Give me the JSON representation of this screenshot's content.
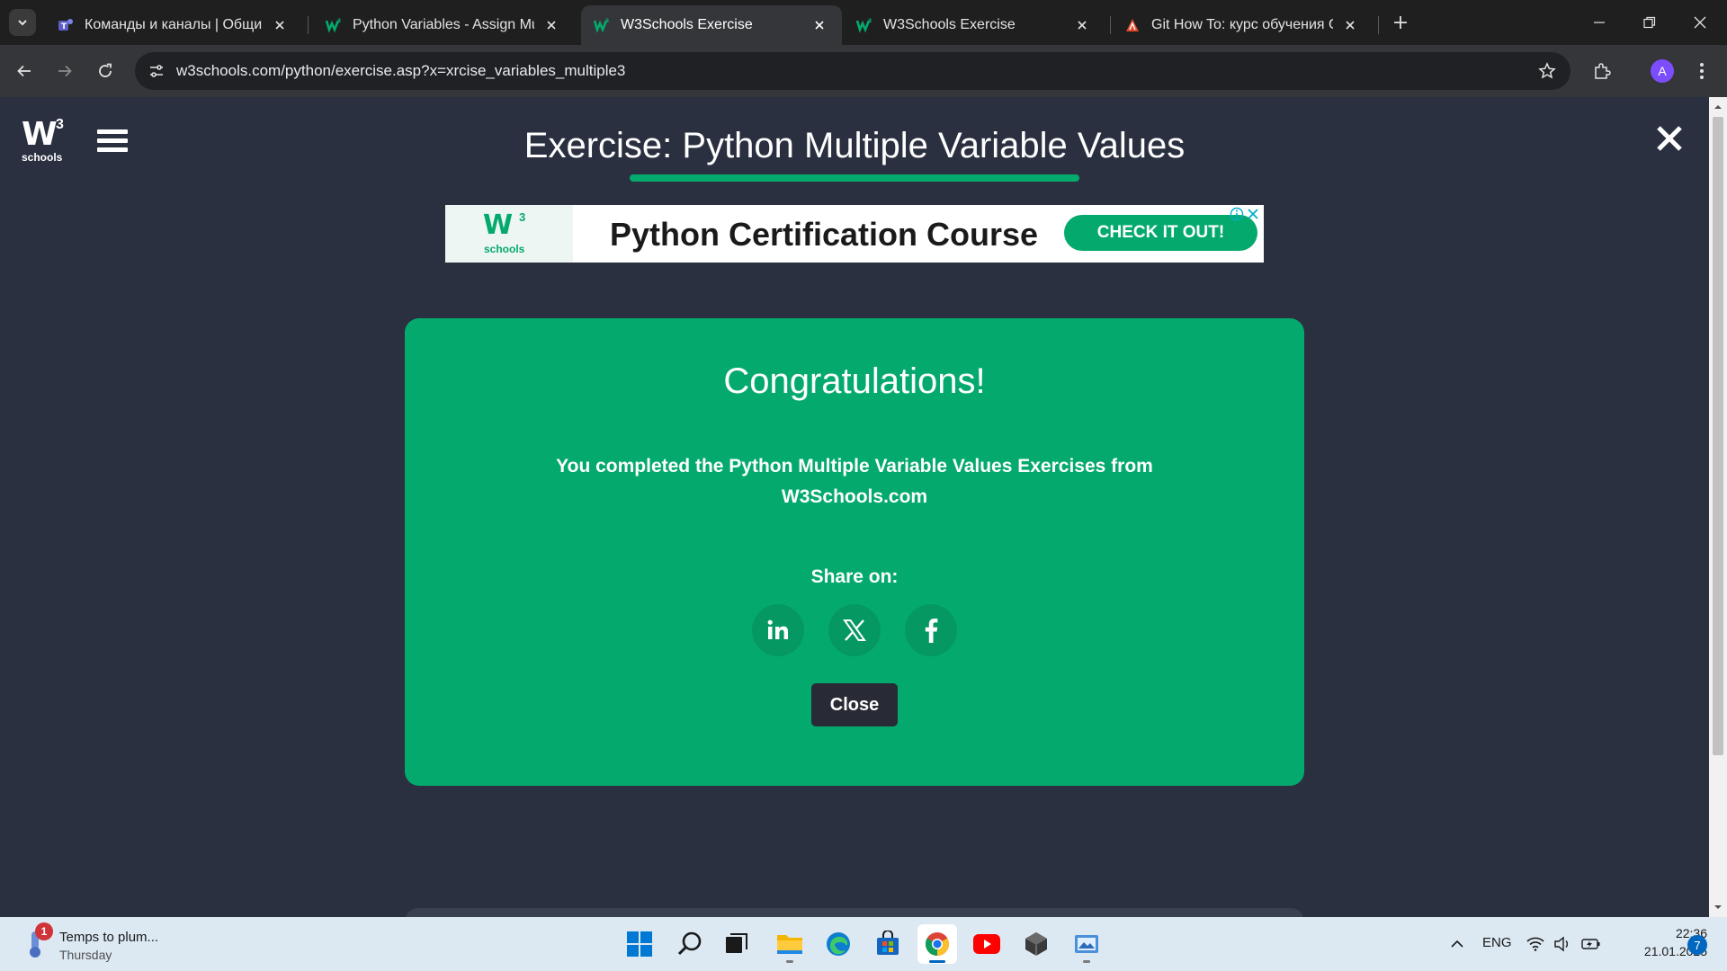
{
  "browser": {
    "tabs": [
      {
        "title": "Команды и каналы | Общий | M",
        "icon": "teams-icon",
        "active": false
      },
      {
        "title": "Python Variables - Assign Multip",
        "icon": "w3schools-favicon",
        "active": false
      },
      {
        "title": "W3Schools Exercise",
        "icon": "w3schools-favicon",
        "active": true
      },
      {
        "title": "W3Schools Exercise",
        "icon": "w3schools-favicon",
        "active": false
      },
      {
        "title": "Git How To: курс обучения Git",
        "icon": "git-howto-icon",
        "active": false
      }
    ],
    "url": "w3schools.com/python/exercise.asp?x=xrcise_variables_multiple3",
    "profile_initial": "A"
  },
  "page": {
    "logo_mark": "W",
    "logo_sup": "3",
    "logo_text": "schools",
    "title": "Exercise: Python Multiple Variable Values",
    "accent_color": "#04aa6d"
  },
  "ad": {
    "logo_mark": "W",
    "logo_sup": "3",
    "logo_text": "schools",
    "headline": "Python Certification Course",
    "cta": "CHECK IT OUT!"
  },
  "modal": {
    "title": "Congratulations!",
    "message": "You completed the Python Multiple Variable Values Exercises from W3Schools.com",
    "share_label": "Share on:",
    "share_icons": [
      "linkedin-icon",
      "x-icon",
      "facebook-icon"
    ],
    "close_label": "Close"
  },
  "taskbar": {
    "weather_badge": "1",
    "weather_title": "Temps to plum...",
    "weather_sub": "Thursday",
    "apps": [
      "windows-start-icon",
      "search-icon",
      "task-view-icon",
      "file-explorer-icon",
      "edge-icon",
      "microsoft-store-icon",
      "chrome-icon",
      "youtube-icon",
      "app-icon",
      "snipping-tool-icon"
    ],
    "language": "ENG",
    "time": "22:36",
    "date": "21.01.2025",
    "notification_count": "7"
  }
}
